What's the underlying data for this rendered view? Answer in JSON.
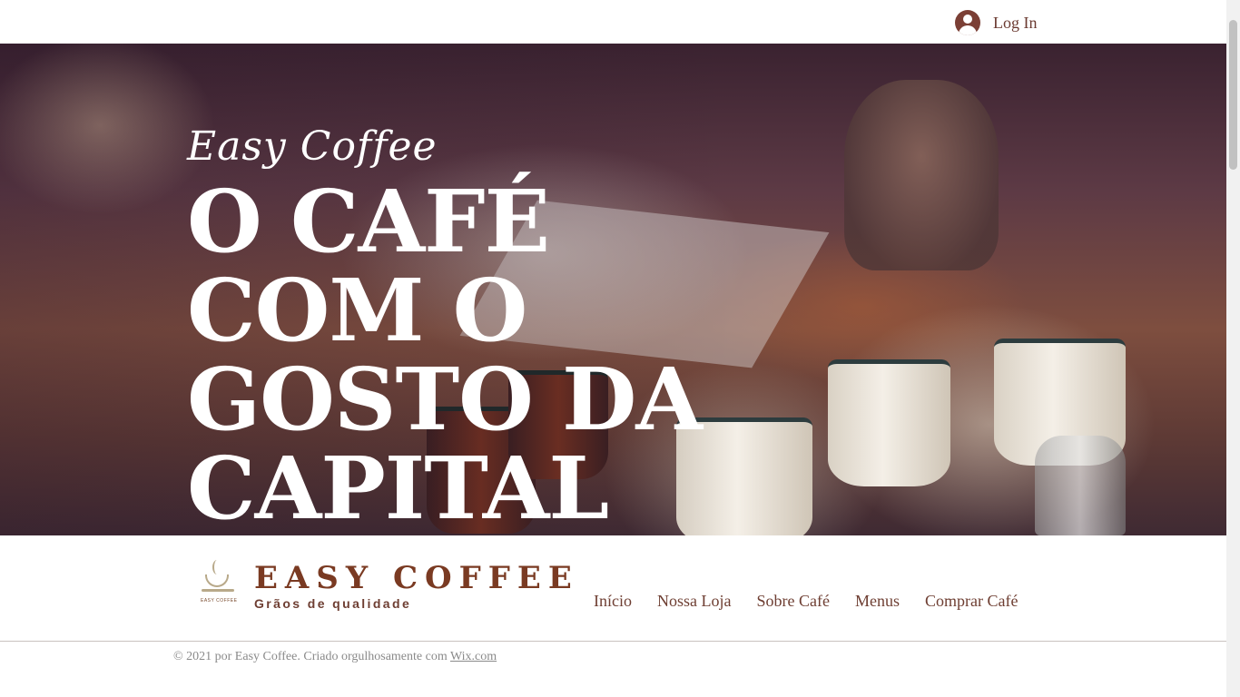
{
  "header": {
    "login_label": "Log In"
  },
  "hero": {
    "subtitle": "Easy Coffee",
    "title_lines": [
      "O CAFÉ",
      "COM O",
      "GOSTO DA",
      "CAPITAL"
    ]
  },
  "footer": {
    "brand_name": "EASY COFFEE",
    "brand_tagline": "Grãos de qualidade",
    "logo_small_text": "EASY COFFEE",
    "nav": {
      "items": [
        {
          "label": "Início"
        },
        {
          "label": "Nossa Loja"
        },
        {
          "label": "Sobre Café"
        },
        {
          "label": "Menus"
        },
        {
          "label": "Comprar Café"
        }
      ]
    },
    "copyright_text": "© 2021 por Easy Coffee. Criado orgulhosamente com ",
    "copyright_link": "Wix.com"
  },
  "colors": {
    "brand": "#7a3a22",
    "nav_text": "#6e3e32",
    "hero_text": "#ffffff"
  },
  "icons": {
    "login": "user-avatar-icon",
    "logo": "coffee-cup-icon"
  }
}
